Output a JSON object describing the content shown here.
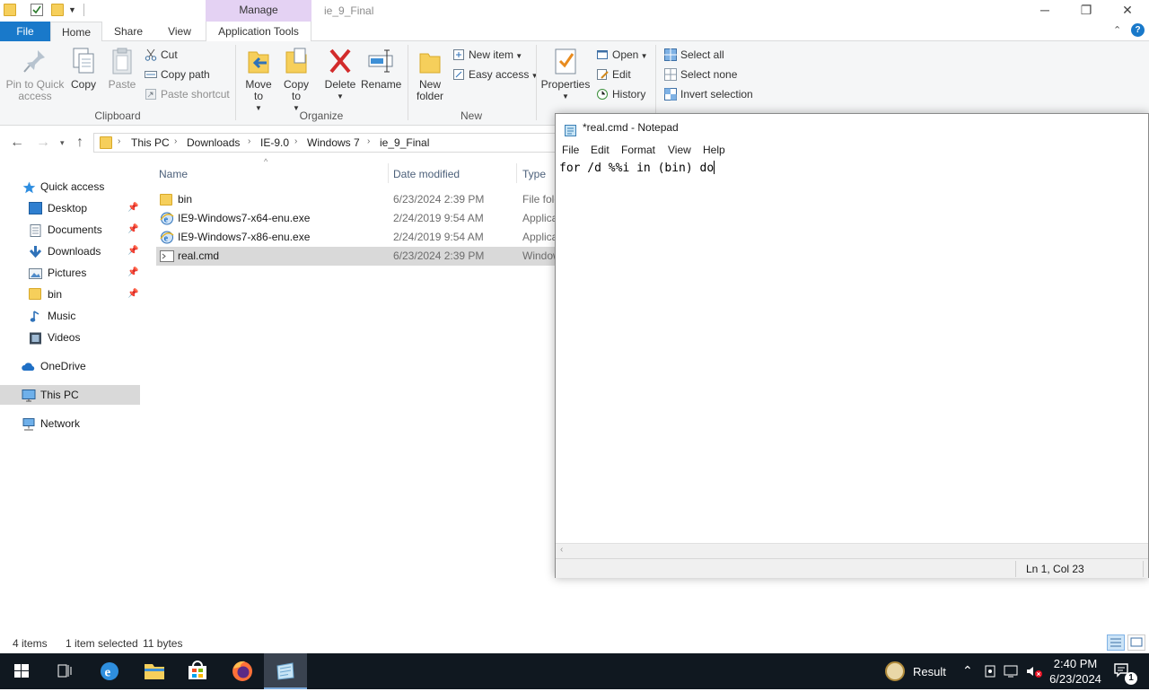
{
  "explorer": {
    "window_title": "ie_9_Final",
    "context_tab": "Manage",
    "window_controls": {
      "minimize": "─",
      "maximize": "❐",
      "close": "✕"
    },
    "tabs": [
      "File",
      "Home",
      "Share",
      "View",
      "Application Tools"
    ],
    "ribbon": {
      "clipboard": {
        "label": "Clipboard",
        "pin": "Pin to Quick access",
        "copy": "Copy",
        "paste": "Paste",
        "cut": "Cut",
        "copy_path": "Copy path",
        "paste_shortcut": "Paste shortcut"
      },
      "organize": {
        "label": "Organize",
        "move_to": "Move to",
        "copy_to": "Copy to",
        "delete": "Delete",
        "rename": "Rename"
      },
      "new": {
        "label": "New",
        "new_folder": "New folder",
        "new_item": "New item",
        "easy_access": "Easy access"
      },
      "open": {
        "properties": "Properties",
        "open": "Open",
        "edit": "Edit",
        "history": "History"
      },
      "select": {
        "select_all": "Select all",
        "select_none": "Select none",
        "invert_selection": "Invert selection"
      }
    },
    "breadcrumb": [
      "This PC",
      "Downloads",
      "IE-9.0",
      "Windows 7",
      "ie_9_Final"
    ],
    "sidebar": {
      "quick_access": "Quick access",
      "items": [
        {
          "label": "Desktop",
          "pinned": true
        },
        {
          "label": "Documents",
          "pinned": true
        },
        {
          "label": "Downloads",
          "pinned": true
        },
        {
          "label": "Pictures",
          "pinned": true
        },
        {
          "label": "bin",
          "pinned": true
        },
        {
          "label": "Music",
          "pinned": false
        },
        {
          "label": "Videos",
          "pinned": false
        }
      ],
      "onedrive": "OneDrive",
      "this_pc": "This PC",
      "network": "Network"
    },
    "columns": {
      "name": "Name",
      "date": "Date modified",
      "type": "Type"
    },
    "files": [
      {
        "name": "bin",
        "date": "6/23/2024 2:39 PM",
        "type": "File folder",
        "icon": "folder-icon"
      },
      {
        "name": "IE9-Windows7-x64-enu.exe",
        "date": "2/24/2019 9:54 AM",
        "type": "Application",
        "icon": "ie-exe-icon"
      },
      {
        "name": "IE9-Windows7-x86-enu.exe",
        "date": "2/24/2019 9:54 AM",
        "type": "Application",
        "icon": "ie-exe-icon"
      },
      {
        "name": "real.cmd",
        "date": "6/23/2024 2:39 PM",
        "type": "Windows Command Script",
        "icon": "cmd-file-icon",
        "selected": true
      }
    ],
    "status": {
      "count": "4 items",
      "selection": "1 item selected",
      "size": "11 bytes"
    }
  },
  "notepad": {
    "title": "*real.cmd - Notepad",
    "menu": [
      "File",
      "Edit",
      "Format",
      "View",
      "Help"
    ],
    "content": "for /d %%i in (bin) do",
    "cursor_pos": "Ln 1, Col 23"
  },
  "taskbar": {
    "tray_label": "Result",
    "time": "2:40 PM",
    "date": "6/23/2024",
    "notification_count": "1"
  },
  "colors": {
    "file_tab": "#1979ca",
    "manage_tab": "#e4d2f3",
    "taskbar": "#101820",
    "selection": "#d9d9d9"
  }
}
